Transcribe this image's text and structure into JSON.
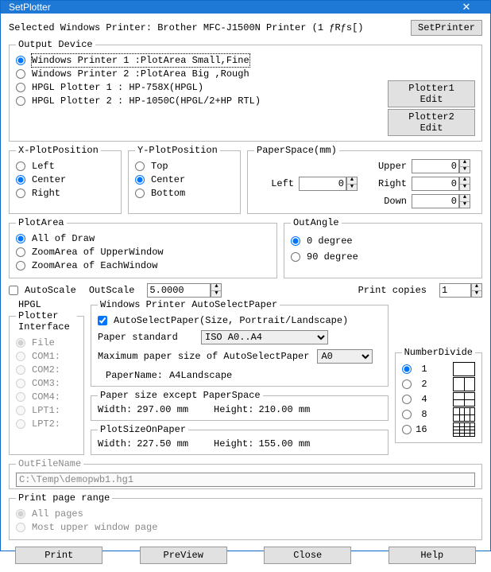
{
  "window": {
    "title": "SetPlotter"
  },
  "header": {
    "selected_label": "Selected Windows Printer: Brother MFC-J1500N Printer (1 ƒRƒs[)",
    "set_printer_btn": "SetPrinter"
  },
  "output_device": {
    "legend": "Output Device",
    "opts": [
      "Windows Printer 1 :PlotArea Small,Fine",
      "Windows Printer 2 :PlotArea Big  ,Rough",
      "HPGL Plotter 1   : HP-758X(HPGL)",
      "HPGL Plotter 2   : HP-1050C(HPGL/2+HP RTL)"
    ],
    "selected": 0,
    "plotter1_edit": "Plotter1 Edit",
    "plotter2_edit": "Plotter2 Edit"
  },
  "xpos": {
    "legend": "X-PlotPosition",
    "opts": [
      "Left",
      "Center",
      "Right"
    ],
    "selected": 1
  },
  "ypos": {
    "legend": "Y-PlotPosition",
    "opts": [
      "Top",
      "Center",
      "Bottom"
    ],
    "selected": 1
  },
  "paperspace": {
    "legend": "PaperSpace(mm)",
    "labels": {
      "upper": "Upper",
      "left": "Left",
      "right": "Right",
      "down": "Down"
    },
    "vals": {
      "upper": "0",
      "left": "0",
      "right": "0",
      "down": "0"
    }
  },
  "plotarea": {
    "legend": "PlotArea",
    "opts": [
      "All of Draw",
      "ZoomArea of UpperWindow",
      "ZoomArea of  EachWindow"
    ],
    "selected": 0
  },
  "outangle": {
    "legend": "OutAngle",
    "opts": [
      "0 degree",
      "90 degree"
    ],
    "selected": 0
  },
  "autoscale": {
    "label": "AutoScale",
    "checked": false
  },
  "outscale": {
    "label": "OutScale",
    "value": "5.0000"
  },
  "printcopies": {
    "label": "Print copies",
    "value": "1"
  },
  "hpgl_iface": {
    "legend": "HPGL Plotter Interface",
    "opts": [
      "File",
      "COM1:",
      "COM2:",
      "COM3:",
      "COM4:",
      "LPT1:",
      "LPT2:"
    ],
    "selected": 0
  },
  "autoselect": {
    "legend": "Windows Printer AutoSelectPaper",
    "check_label": "AutoSelectPaper(Size, Portrait/Landscape)",
    "checked": true,
    "paper_std_label": "Paper standard",
    "paper_std_value": "ISO A0..A4",
    "max_label": "Maximum paper size of AutoSelectPaper",
    "max_value": "A0",
    "papername_label": "PaperName:",
    "papername_value": "A4Landscape"
  },
  "papersize_except": {
    "legend": "Paper size except PaperSpace",
    "width_label": "Width:",
    "width_value": "297.00 mm",
    "height_label": "Height:",
    "height_value": "210.00 mm"
  },
  "plotsize": {
    "legend": "PlotSizeOnPaper",
    "width_label": "Width:",
    "width_value": "227.50 mm",
    "height_label": "Height:",
    "height_value": "155.00 mm"
  },
  "numdivide": {
    "legend": "NumberDivide",
    "opts": [
      "1",
      "2",
      "4",
      "8",
      "16"
    ],
    "selected": 0
  },
  "outfilename": {
    "legend": "OutFileName",
    "value": "C:\\Temp\\demopwb1.hg1"
  },
  "pagerange": {
    "legend": "Print page range",
    "opts": [
      "All pages",
      "Most upper window page"
    ],
    "selected": 0
  },
  "buttons": {
    "print": "Print",
    "preview": "PreView",
    "close": "Close",
    "help": "Help"
  }
}
